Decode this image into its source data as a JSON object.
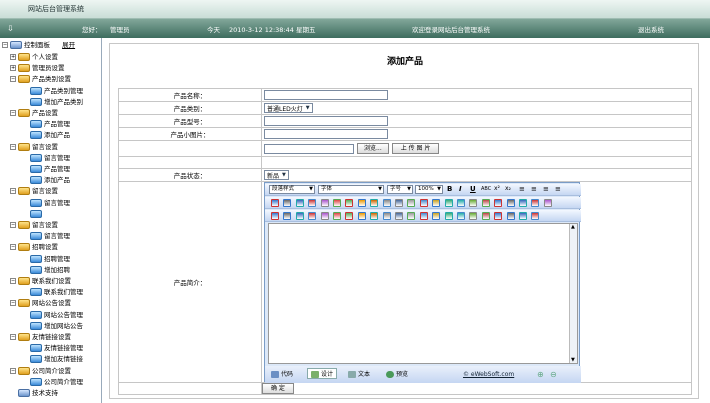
{
  "app": {
    "title": "网站后台管理系统"
  },
  "infobar": {
    "greeting": "您好：",
    "user": "管理员",
    "today_label": "今天",
    "datetime": "2010-3-12 12:38:44 星期五",
    "welcome": "欢迎登录网站后台管理系统",
    "logout": "退出系统"
  },
  "sidebar": {
    "root": "控制面板",
    "expand": "展开",
    "nodes": [
      {
        "label": "个人设置",
        "kind": "grp"
      },
      {
        "label": "管理员设置",
        "kind": "grp"
      },
      {
        "label": "产品类别设置",
        "kind": "grp"
      },
      {
        "label": "产品类别管理",
        "kind": "leaf"
      },
      {
        "label": "增加产品类别",
        "kind": "leaf"
      },
      {
        "label": "产品设置",
        "kind": "grp"
      },
      {
        "label": "产品管理",
        "kind": "leaf"
      },
      {
        "label": "添加产品",
        "kind": "leaf"
      },
      {
        "label": "留言设置",
        "kind": "grp"
      },
      {
        "label": "留言管理",
        "kind": "leaf"
      },
      {
        "label": "产品管理",
        "kind": "leaf"
      },
      {
        "label": "添加产品",
        "kind": "leaf"
      },
      {
        "label": "留言设置",
        "kind": "grp"
      },
      {
        "label": "留言管理",
        "kind": "leaf"
      },
      {
        "label": "",
        "kind": "leaf"
      },
      {
        "label": "留言设置",
        "kind": "grp"
      },
      {
        "label": "留言管理",
        "kind": "leaf"
      },
      {
        "label": "招聘设置",
        "kind": "grp"
      },
      {
        "label": "招聘管理",
        "kind": "leaf"
      },
      {
        "label": "增加招聘",
        "kind": "leaf"
      },
      {
        "label": "联系我们设置",
        "kind": "grp"
      },
      {
        "label": "联系我们管理",
        "kind": "leaf"
      },
      {
        "label": "网站公告设置",
        "kind": "grp"
      },
      {
        "label": "网站公告管理",
        "kind": "leaf"
      },
      {
        "label": "增加网站公告",
        "kind": "leaf"
      },
      {
        "label": "友情链接设置",
        "kind": "grp"
      },
      {
        "label": "友情链接管理",
        "kind": "leaf"
      },
      {
        "label": "增加友情链接",
        "kind": "leaf"
      },
      {
        "label": "公司简介设置",
        "kind": "grp"
      },
      {
        "label": "公司简介管理",
        "kind": "leaf"
      },
      {
        "label": "技术支持",
        "kind": "root"
      }
    ]
  },
  "form": {
    "title": "添加产品",
    "name_label": "产品名称：",
    "category_label": "产品类别：",
    "category_value": "普通LED火灯",
    "model_label": "产品型号：",
    "image_label": "产品小图片：",
    "browse": "浏览...",
    "upload": "上 传 图 片",
    "status_label": "产品状态：",
    "status_value": "新品",
    "intro_label": "产品简介：",
    "submit": "确 定"
  },
  "editor": {
    "para_style": "段落样式",
    "font": "字体",
    "size": "字号",
    "zoom": "100%",
    "tabs": [
      "代码",
      "设计",
      "文本",
      "预览"
    ],
    "brand": "© eWebSoft.com"
  }
}
